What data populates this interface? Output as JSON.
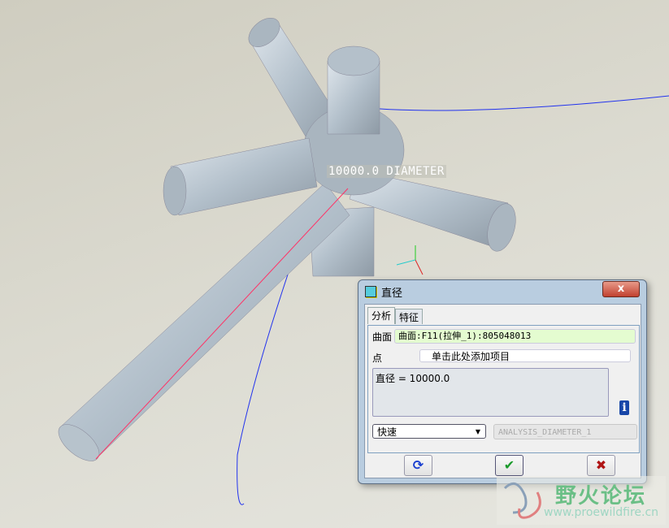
{
  "viewport": {
    "dimension_label": "10000.0 DIAMETER"
  },
  "dialog": {
    "title": "直径",
    "close_label": "x",
    "tabs": [
      {
        "label": "分析",
        "active": true
      },
      {
        "label": "特征",
        "active": false
      }
    ],
    "surface_label": "曲面",
    "surface_value": "曲面:F11(拉伸_1):805048013",
    "point_label": "点",
    "point_placeholder": "单击此处添加项目",
    "result_text": "直径 = 10000.0",
    "info_icon": "i",
    "mode_select": "快速",
    "feature_name": "ANALYSIS_DIAMETER_1",
    "buttons": {
      "repeat": "⟳",
      "ok": "✔",
      "cancel": "✖"
    }
  },
  "watermark": {
    "title": "野火论坛",
    "url": "www.proewildfire.cn"
  }
}
